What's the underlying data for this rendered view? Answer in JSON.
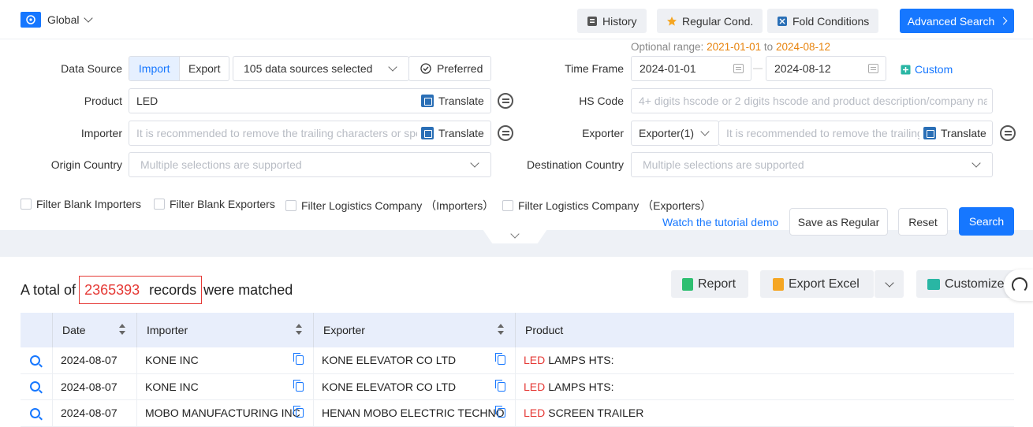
{
  "topbar": {
    "scope_label": "Global",
    "buttons": {
      "history": "History",
      "regular": "Regular Cond.",
      "fold": "Fold Conditions",
      "advanced": "Advanced Search"
    }
  },
  "colors": {
    "accent": "#1677ff",
    "highlight": "#e53935",
    "range_date": "#e8830c"
  },
  "range": {
    "label": "Optional range:",
    "from": "2021-01-01",
    "to_word": "to",
    "to": "2024-08-12"
  },
  "filters": {
    "data_source": {
      "label": "Data Source",
      "options": [
        "Import",
        "Export"
      ],
      "selected": "Import",
      "sources_value": "105 data sources selected",
      "preferred": "Preferred"
    },
    "time_frame": {
      "label": "Time Frame",
      "start": "2024-01-01",
      "dash": "—",
      "end": "2024-08-12",
      "custom": "Custom"
    },
    "product": {
      "label": "Product",
      "value": "LED",
      "translate": "Translate"
    },
    "hs_code": {
      "label": "HS Code",
      "placeholder": "4+ digits hscode or 2 digits hscode and product description/company na..."
    },
    "importer": {
      "label": "Importer",
      "placeholder": "It is recommended to remove the trailing characters or spe",
      "translate": "Translate"
    },
    "exporter": {
      "label": "Exporter",
      "select_value": "Exporter(1)",
      "placeholder": "It is recommended to remove the trailing",
      "translate": "Translate"
    },
    "origin_country": {
      "label": "Origin Country",
      "placeholder": "Multiple selections are supported"
    },
    "destination_country": {
      "label": "Destination Country",
      "placeholder": "Multiple selections are supported"
    },
    "checkboxes": [
      "Filter Blank Importers",
      "Filter Blank Exporters",
      "Filter Logistics Company （Importers）",
      "Filter Logistics Company （Exporters）"
    ],
    "tutorial_link": "Watch the tutorial demo",
    "save_regular": "Save as Regular",
    "reset": "Reset",
    "search": "Search"
  },
  "results": {
    "prefix": "A total of",
    "count": "2365393",
    "records_word": "records",
    "suffix": "were matched",
    "report": "Report",
    "export_excel": "Export Excel",
    "customize": "Customize"
  },
  "table": {
    "columns": [
      "Date",
      "Importer",
      "Exporter",
      "Product"
    ],
    "rows": [
      {
        "date": "2024-08-07",
        "importer": "KONE INC",
        "exporter": "KONE ELEVATOR CO LTD",
        "product_kw": "LED",
        "product_rest": "LAMPS HTS:"
      },
      {
        "date": "2024-08-07",
        "importer": "KONE INC",
        "exporter": "KONE ELEVATOR CO LTD",
        "product_kw": "LED",
        "product_rest": "LAMPS HTS:"
      },
      {
        "date": "2024-08-07",
        "importer": "MOBO MANUFACTURING INC",
        "exporter": "HENAN MOBO ELECTRIC TECHNO",
        "product_kw": "LED",
        "product_rest": "SCREEN TRAILER"
      }
    ]
  }
}
